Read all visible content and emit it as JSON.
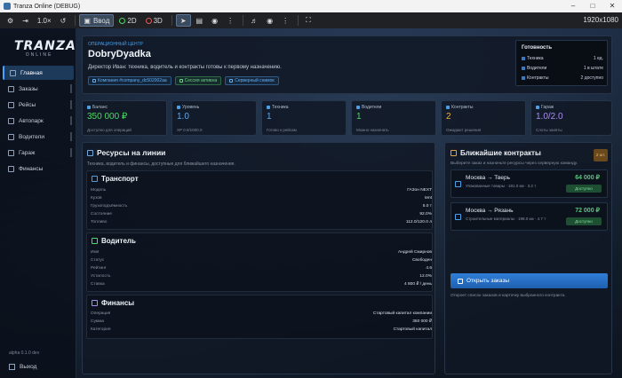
{
  "window": {
    "title": "Tranza Online (DEBUG)"
  },
  "toolbar": {
    "speed": "1.0×",
    "input_label": "Ввод",
    "mode_2d": "2D",
    "mode_3d": "3D",
    "resolution": "1920x1080"
  },
  "logo": {
    "line1": "TRANZA",
    "line2": "ONLINE"
  },
  "sidebar": {
    "items": [
      {
        "label": "Главная"
      },
      {
        "label": "Заказы"
      },
      {
        "label": "Рейсы"
      },
      {
        "label": "Автопарк"
      },
      {
        "label": "Водители"
      },
      {
        "label": "Гараж"
      },
      {
        "label": "Финансы"
      }
    ],
    "version": "alpha 0.1.0 dev",
    "exit": "Выход"
  },
  "hero": {
    "sup": "ОПЕРАЦИОННЫЙ ЦЕНТР",
    "name": "DobryDyadka",
    "desc": "Директор Иван: техника, водитель и контракты готовы к первому назначению.",
    "chips": [
      "Компания #company_dc502002aa",
      "Сессия активна",
      "Серверный снимок"
    ]
  },
  "ready": {
    "title": "Готовность",
    "rows": [
      {
        "label": "Техника",
        "value": "1 ед."
      },
      {
        "label": "Водители",
        "value": "1 в штате"
      },
      {
        "label": "Контракты",
        "value": "2 доступно"
      }
    ]
  },
  "stats": [
    {
      "label": "Баланс",
      "value": "350 000 ₽",
      "sub": "Доступно для операций",
      "color": "#4cd964"
    },
    {
      "label": "Уровень",
      "value": "1.0",
      "sub": "XP 0.0/1000.0",
      "color": "#5aa9f0"
    },
    {
      "label": "Техника",
      "value": "1",
      "sub": "Готово к рейсам",
      "color": "#5aa9f0"
    },
    {
      "label": "Водители",
      "value": "1",
      "sub": "Можно назначать",
      "color": "#4cd964"
    },
    {
      "label": "Контракты",
      "value": "2",
      "sub": "Ожидают решения",
      "color": "#f0b042"
    },
    {
      "label": "Гараж",
      "value": "1.0/2.0",
      "sub": "Слоты заняты",
      "color": "#a98cf0"
    }
  ],
  "resources": {
    "title": "Ресурсы на линии",
    "subtitle": "Техника, водитель и финансы, доступные для ближайшего назначения.",
    "transport": {
      "title": "Транспорт",
      "rows": [
        {
          "k": "Модель",
          "v": "ГАЗон NEXT"
        },
        {
          "k": "Кузов",
          "v": "tent"
        },
        {
          "k": "Грузоподъёмность",
          "v": "5.0 т"
        },
        {
          "k": "Состояние",
          "v": "92.0%"
        },
        {
          "k": "Топливо",
          "v": "112.0/120.0 л"
        }
      ]
    },
    "driver": {
      "title": "Водитель",
      "rows": [
        {
          "k": "Имя",
          "v": "Андрей Смирнов"
        },
        {
          "k": "Статус",
          "v": "Свободен"
        },
        {
          "k": "Рейтинг",
          "v": "4.6"
        },
        {
          "k": "Усталость",
          "v": "12.0%"
        },
        {
          "k": "Ставка",
          "v": "4 800 ₽ / день"
        }
      ]
    },
    "finance": {
      "title": "Финансы",
      "rows": [
        {
          "k": "Операция",
          "v": "Стартовый капитал компании"
        },
        {
          "k": "Сумма",
          "v": "350 000 ₽"
        },
        {
          "k": "Категория",
          "v": "Стартовый капитал"
        }
      ]
    }
  },
  "contracts": {
    "title": "Ближайшие контракты",
    "subtitle": "Выберите заказ и назначьте ресурсы через серверную команду.",
    "badge": "2 шт.",
    "cards": [
      {
        "route": "Москва → Тверь",
        "cargo": "Упакованные товары · 181.0 км · 3.2 т",
        "price": "64 000 ₽",
        "status": "Доступно"
      },
      {
        "route": "Москва → Рязань",
        "cargo": "Строительные материалы · 198.0 км · 4.7 т",
        "price": "72 000 ₽",
        "status": "Доступно"
      }
    ],
    "open_button": "Открыть заказы",
    "footer": "Откроет список заказов и карточку выбранного контракта."
  }
}
